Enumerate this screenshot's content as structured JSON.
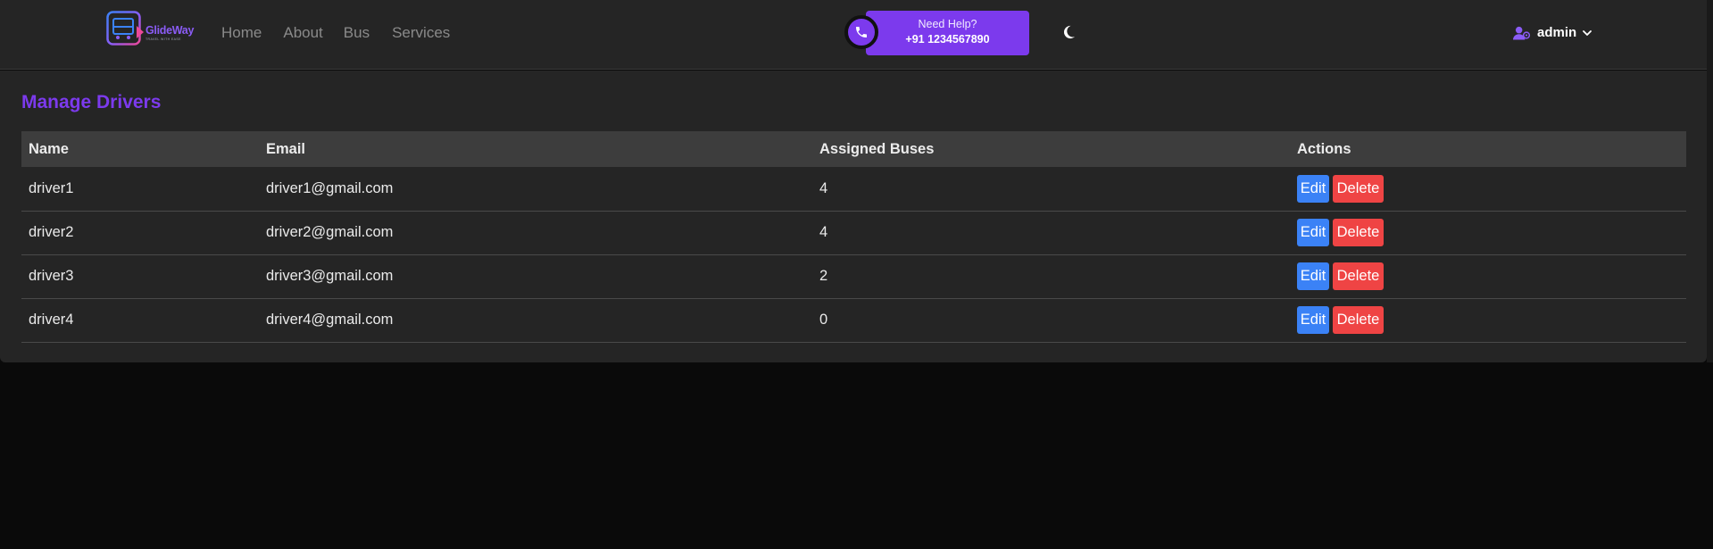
{
  "header": {
    "logo": {
      "brand": "GlideWay",
      "tagline": "TRAVEL WITH EASE",
      "icon": "bus-logo-icon"
    },
    "nav": [
      {
        "label": "Home"
      },
      {
        "label": "About"
      },
      {
        "label": "Bus"
      },
      {
        "label": "Services"
      }
    ],
    "help": {
      "label": "Need Help?",
      "phone": "+91 1234567890",
      "icon": "phone-icon"
    },
    "theme_toggle_icon": "moon-icon",
    "user": {
      "name": "admin",
      "icon": "user-icon",
      "dropdown_icon": "chevron-down-icon"
    }
  },
  "main": {
    "title": "Manage Drivers",
    "table": {
      "columns": [
        "Name",
        "Email",
        "Assigned Buses",
        "Actions"
      ],
      "rows": [
        {
          "name": "driver1",
          "email": "driver1@gmail.com",
          "assigned_buses": "4"
        },
        {
          "name": "driver2",
          "email": "driver2@gmail.com",
          "assigned_buses": "4"
        },
        {
          "name": "driver3",
          "email": "driver3@gmail.com",
          "assigned_buses": "2"
        },
        {
          "name": "driver4",
          "email": "driver4@gmail.com",
          "assigned_buses": "0"
        }
      ],
      "actions": {
        "edit_label": "Edit",
        "delete_label": "Delete"
      }
    }
  },
  "colors": {
    "accent": "#7c3aed",
    "edit": "#3b82f6",
    "delete": "#ef4444",
    "surface": "#252525",
    "background": "#0a0a0a"
  }
}
